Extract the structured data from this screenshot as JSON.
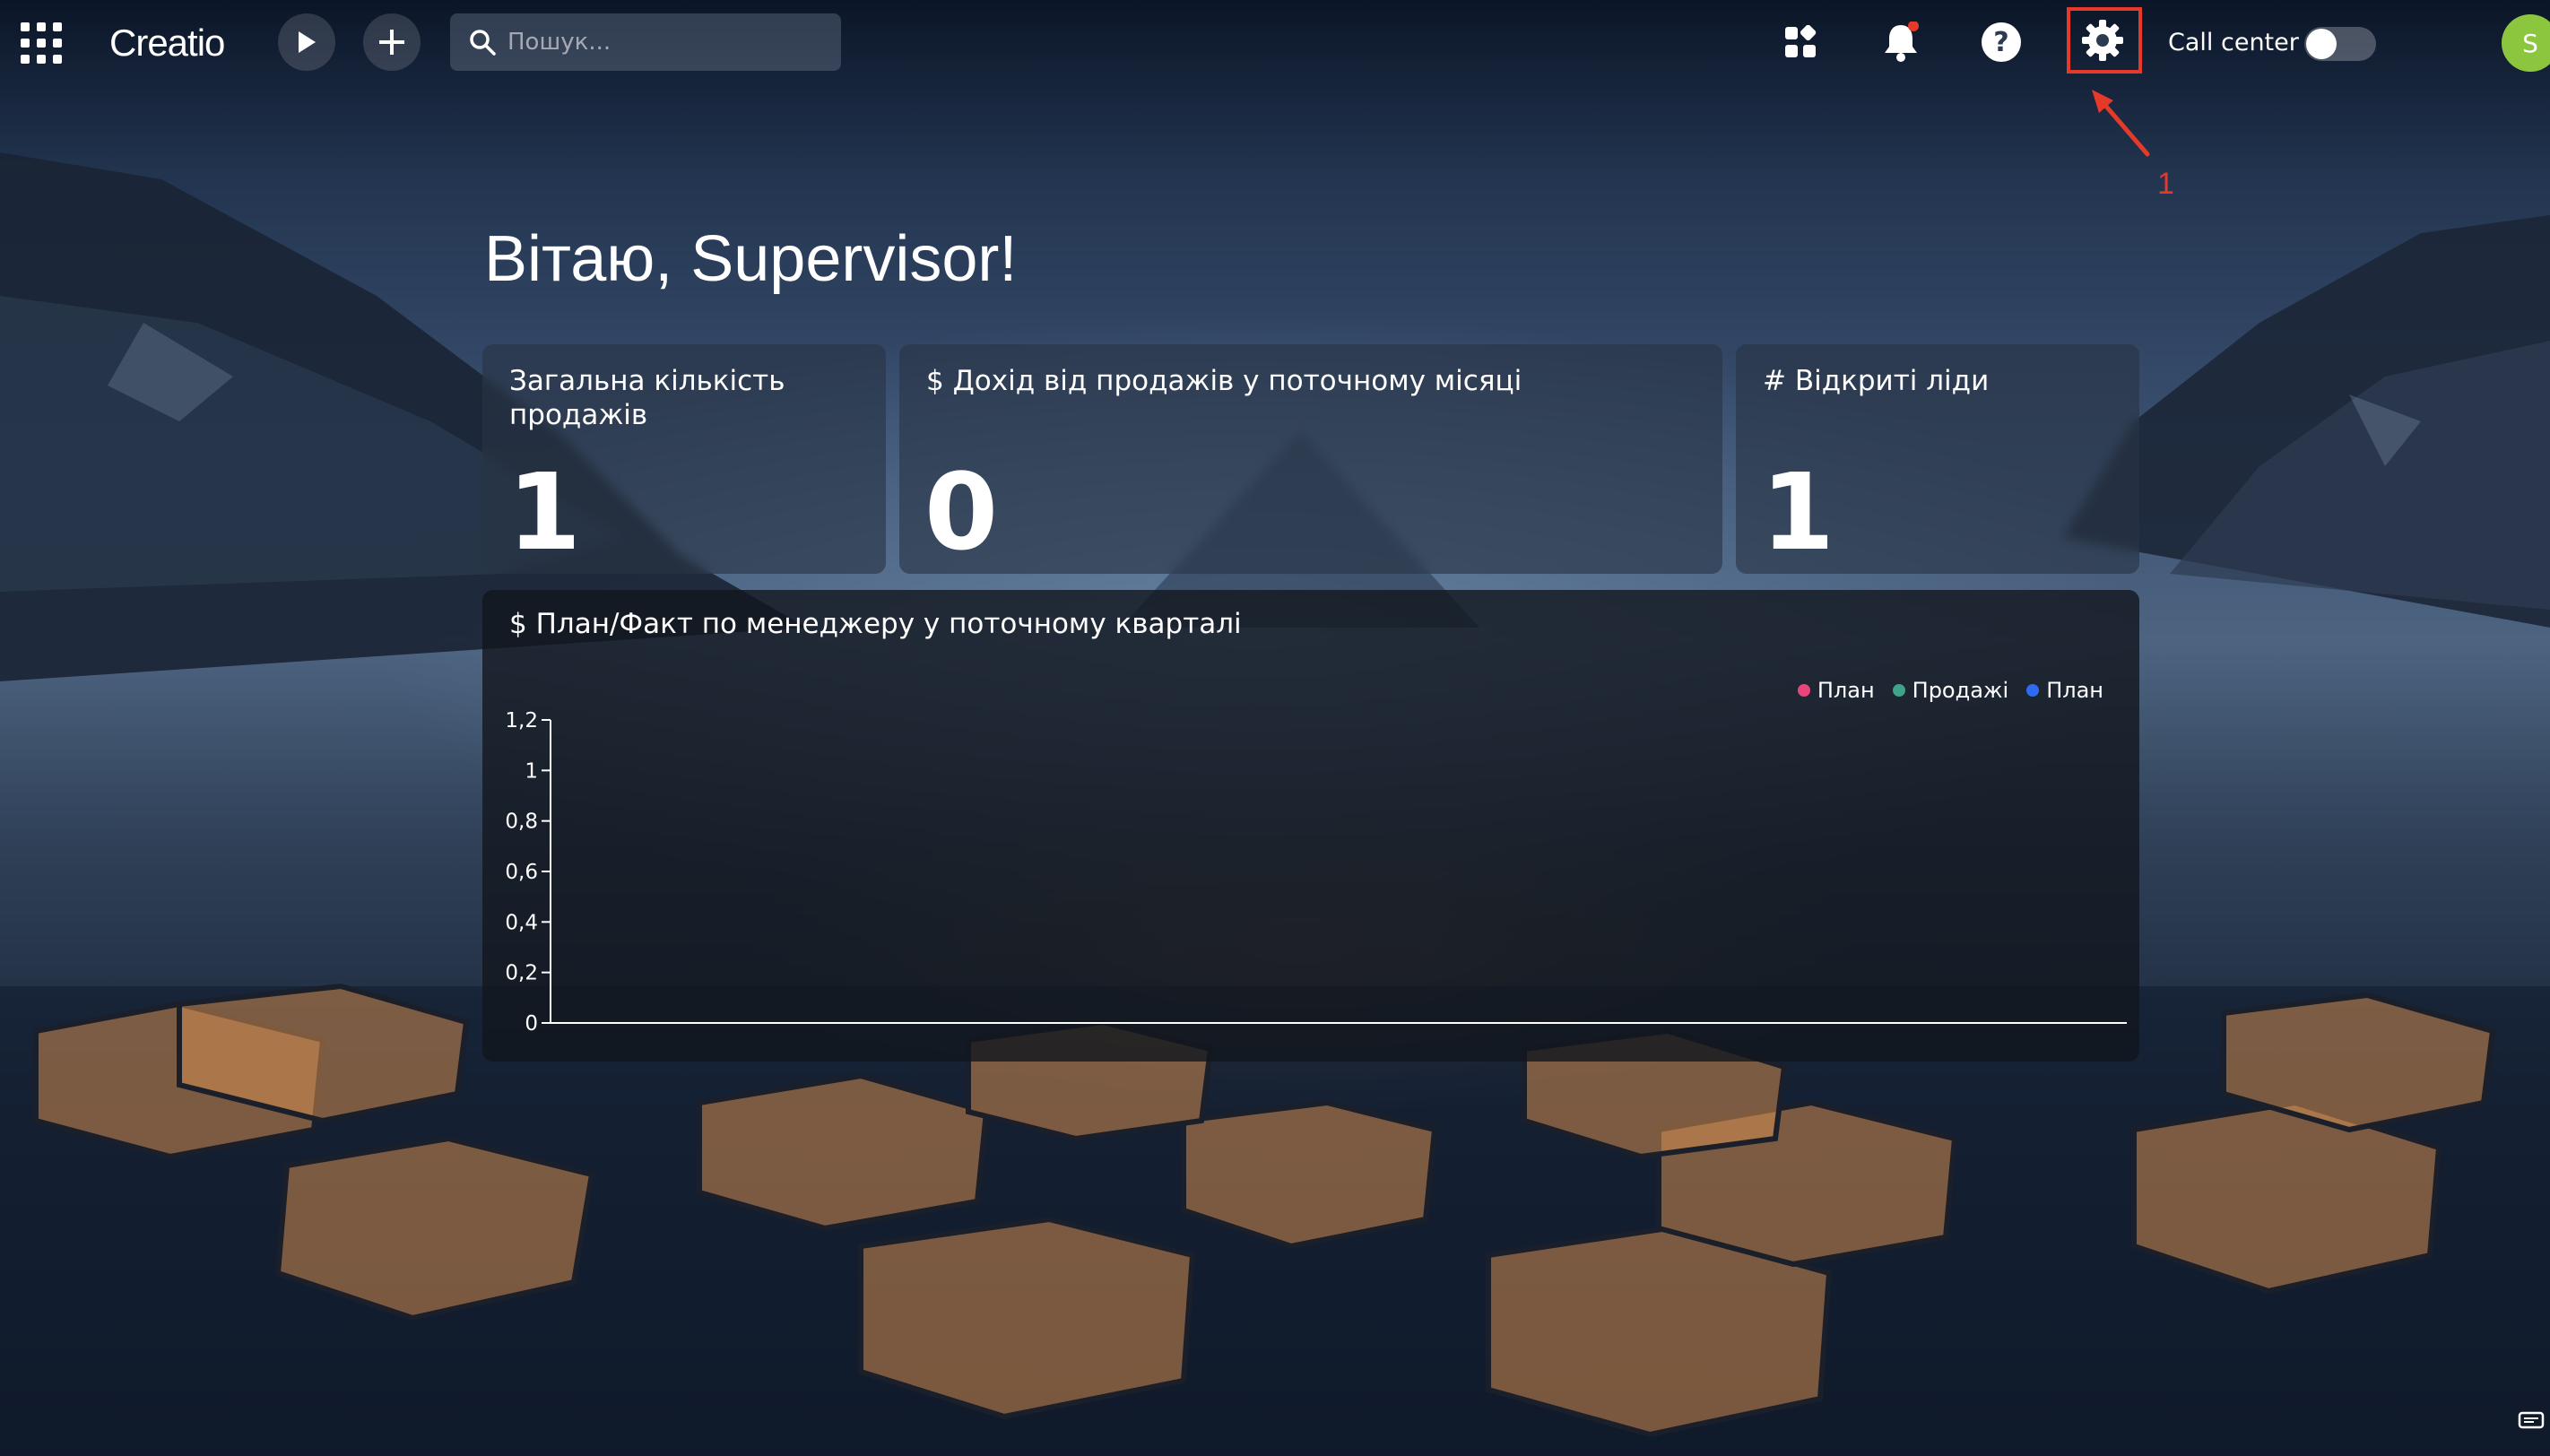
{
  "topbar": {
    "logo": "Creatio",
    "search_placeholder": "Пошук...",
    "call_center_label": "Call center",
    "avatar_initial": "S",
    "icons": [
      "apps-grid-icon",
      "play-icon",
      "plus-icon",
      "search-icon",
      "widgets-icon",
      "bell-icon",
      "help-icon",
      "gear-icon"
    ]
  },
  "annotation": {
    "number": "1",
    "color": "#e5392a"
  },
  "main": {
    "greeting": "Вітаю, Supervisor!",
    "cards": [
      {
        "title": "Загальна кількість продажів",
        "value": "1"
      },
      {
        "title": "$ Дохід від продажів у поточному місяці",
        "value": "0"
      },
      {
        "title": "# Відкриті ліди",
        "value": "1"
      }
    ]
  },
  "chart_data": {
    "type": "bar",
    "title": "$ План/Факт по менеджеру у поточному кварталі",
    "categories": [],
    "series": [
      {
        "name": "План",
        "color": "#e8457c",
        "values": []
      },
      {
        "name": "Продажі",
        "color": "#3fa28a",
        "values": []
      },
      {
        "name": "План",
        "color": "#2f6bf0",
        "values": []
      }
    ],
    "ylim": [
      0,
      1.2
    ],
    "yticks": [
      "0",
      "0,2",
      "0,4",
      "0,6",
      "0,8",
      "1",
      "1,2"
    ],
    "legend_position": "top-right",
    "grid": false
  }
}
